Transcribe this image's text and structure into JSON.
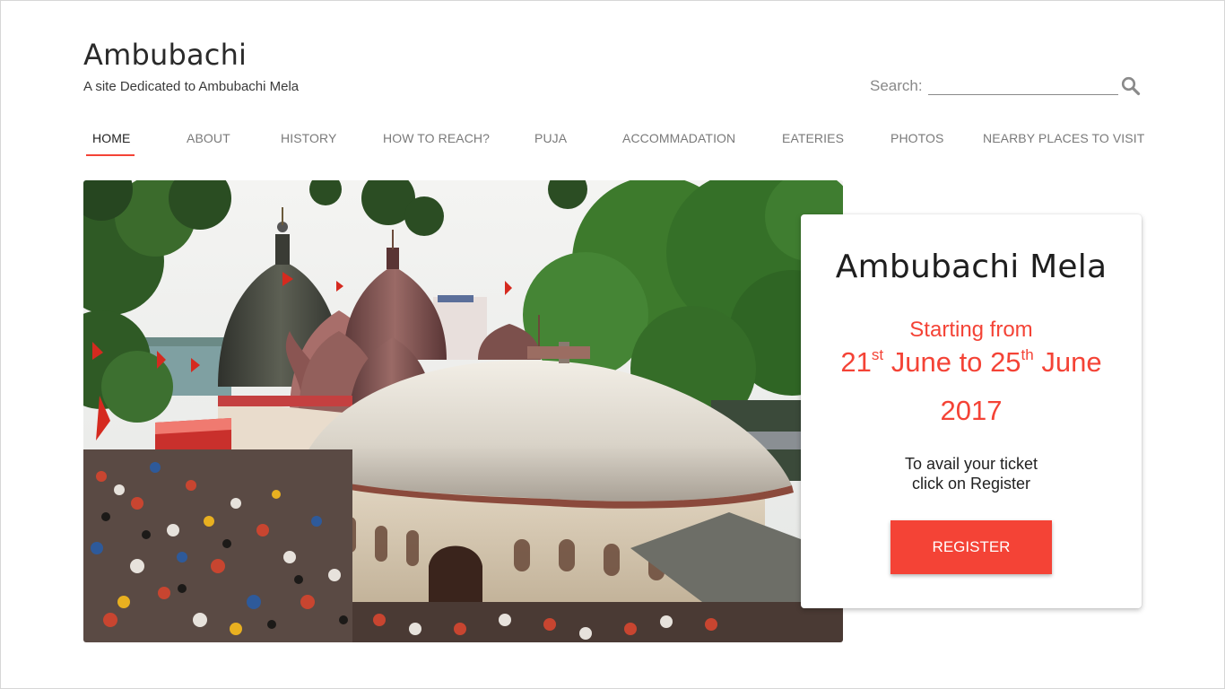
{
  "site": {
    "title": "Ambubachi",
    "tagline": "A site Dedicated to Ambubachi Mela"
  },
  "search": {
    "label": "Search:",
    "value": "",
    "placeholder": "",
    "icon": "search-icon"
  },
  "nav": {
    "active_color": "#f44336",
    "items": [
      {
        "label": "HOME",
        "active": true
      },
      {
        "label": "ABOUT"
      },
      {
        "label": "HISTORY"
      },
      {
        "label": "HOW TO REACH?"
      },
      {
        "label": "PUJA"
      },
      {
        "label": "ACCOMMADATION"
      },
      {
        "label": "EATERIES"
      },
      {
        "label": "PHOTOS"
      },
      {
        "label": "NEARBY PLACES TO VISIT"
      }
    ]
  },
  "hero": {
    "image": "kamakhya-temple-photo"
  },
  "card": {
    "title": "Ambubachi Mela",
    "starting": "Starting from",
    "start_day": "21",
    "start_suffix": "st",
    "start_month": "June to",
    "end_day": "25",
    "end_suffix": "th",
    "end_month": "June",
    "year": "2017",
    "note": "To avail your ticket\n click on Register",
    "button": "REGISTER",
    "accent": "#f44336"
  }
}
